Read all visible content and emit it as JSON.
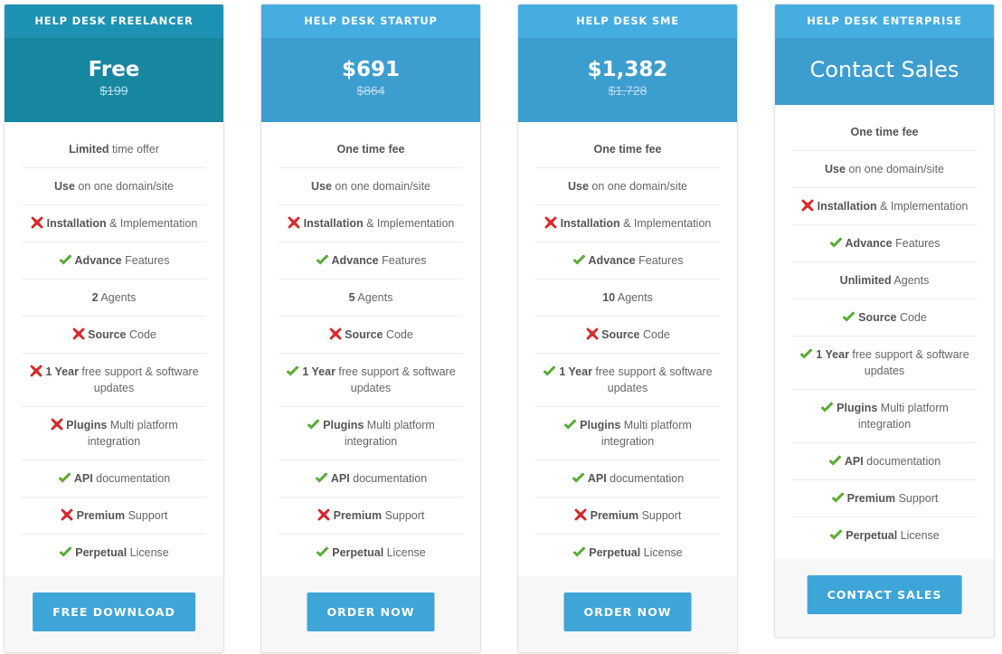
{
  "plans": [
    {
      "name": "HELP DESK FREELANCER",
      "price": "Free",
      "old_price": "$199",
      "features": [
        {
          "icon": "none",
          "bold": "Limited",
          "text": " time offer"
        },
        {
          "icon": "none",
          "bold": "Use",
          "text": " on one domain/site"
        },
        {
          "icon": "cross",
          "bold": "Installation",
          "text": " & Implementation"
        },
        {
          "icon": "check",
          "bold": "Advance",
          "text": " Features"
        },
        {
          "icon": "none",
          "bold": "2",
          "text": " Agents"
        },
        {
          "icon": "cross",
          "bold": "Source",
          "text": " Code"
        },
        {
          "icon": "cross",
          "bold": "1 Year",
          "text": " free support & software updates"
        },
        {
          "icon": "cross",
          "bold": "Plugins",
          "text": " Multi platform integration"
        },
        {
          "icon": "check",
          "bold": "API",
          "text": " documentation"
        },
        {
          "icon": "cross",
          "bold": "Premium",
          "text": " Support"
        },
        {
          "icon": "check",
          "bold": "Perpetual",
          "text": " License"
        }
      ],
      "button": "FREE DOWNLOAD"
    },
    {
      "name": "HELP DESK STARTUP",
      "price": "$691",
      "old_price": "$864",
      "features": [
        {
          "icon": "none",
          "bold": "One time fee",
          "text": ""
        },
        {
          "icon": "none",
          "bold": "Use",
          "text": " on one domain/site"
        },
        {
          "icon": "cross",
          "bold": "Installation",
          "text": " & Implementation"
        },
        {
          "icon": "check",
          "bold": "Advance",
          "text": " Features"
        },
        {
          "icon": "none",
          "bold": "5",
          "text": " Agents"
        },
        {
          "icon": "cross",
          "bold": "Source",
          "text": " Code"
        },
        {
          "icon": "check",
          "bold": "1 Year",
          "text": " free support & software updates"
        },
        {
          "icon": "check",
          "bold": "Plugins",
          "text": " Multi platform integration"
        },
        {
          "icon": "check",
          "bold": "API",
          "text": " documentation"
        },
        {
          "icon": "cross",
          "bold": "Premium",
          "text": " Support"
        },
        {
          "icon": "check",
          "bold": "Perpetual",
          "text": " License"
        }
      ],
      "button": "ORDER NOW"
    },
    {
      "name": "HELP DESK SME",
      "price": "$1,382",
      "old_price": "$1,728",
      "features": [
        {
          "icon": "none",
          "bold": "One time fee",
          "text": ""
        },
        {
          "icon": "none",
          "bold": "Use",
          "text": " on one domain/site"
        },
        {
          "icon": "cross",
          "bold": "Installation",
          "text": " & Implementation"
        },
        {
          "icon": "check",
          "bold": "Advance",
          "text": " Features"
        },
        {
          "icon": "none",
          "bold": "10",
          "text": " Agents"
        },
        {
          "icon": "cross",
          "bold": "Source",
          "text": " Code"
        },
        {
          "icon": "check",
          "bold": "1 Year",
          "text": " free support & software updates"
        },
        {
          "icon": "check",
          "bold": "Plugins",
          "text": " Multi platform integration"
        },
        {
          "icon": "check",
          "bold": "API",
          "text": " documentation"
        },
        {
          "icon": "cross",
          "bold": "Premium",
          "text": " Support"
        },
        {
          "icon": "check",
          "bold": "Perpetual",
          "text": " License"
        }
      ],
      "button": "ORDER NOW"
    },
    {
      "name": "HELP DESK ENTERPRISE",
      "price": "Contact Sales",
      "old_price": "",
      "features": [
        {
          "icon": "none",
          "bold": "One time fee",
          "text": ""
        },
        {
          "icon": "none",
          "bold": "Use",
          "text": " on one domain/site"
        },
        {
          "icon": "cross",
          "bold": "Installation",
          "text": " & Implementation"
        },
        {
          "icon": "check",
          "bold": "Advance",
          "text": " Features"
        },
        {
          "icon": "none",
          "bold": "Unlimited",
          "text": " Agents"
        },
        {
          "icon": "check",
          "bold": "Source",
          "text": " Code"
        },
        {
          "icon": "check",
          "bold": "1 Year",
          "text": " free support & software updates"
        },
        {
          "icon": "check",
          "bold": "Plugins",
          "text": " Multi platform integration"
        },
        {
          "icon": "check",
          "bold": "API",
          "text": " documentation"
        },
        {
          "icon": "check",
          "bold": "Premium",
          "text": " Support"
        },
        {
          "icon": "check",
          "bold": "Perpetual",
          "text": " License"
        }
      ],
      "button": "CONTACT SALES"
    }
  ],
  "colors": {
    "freelancer_header": "#1c93b4",
    "freelancer_price_bg": "#17869f",
    "header": "#45ade0",
    "price_bg": "#3c9dcf",
    "button": "#3ea5d8",
    "check": "#5cb531",
    "cross": "#e0272b"
  }
}
